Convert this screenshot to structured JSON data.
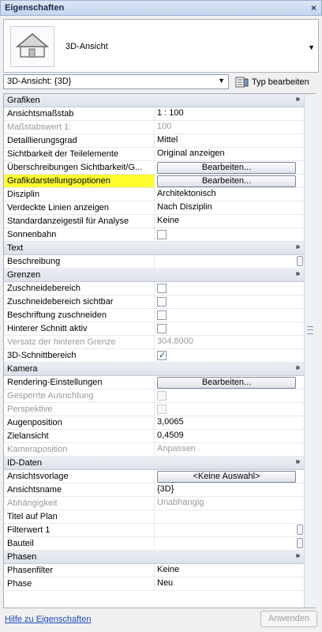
{
  "window": {
    "title": "Eigenschaften",
    "close": "×"
  },
  "type_selector": {
    "name": "3D-Ansicht"
  },
  "view_select": {
    "value": "3D-Ansicht: {3D}"
  },
  "edit_type": {
    "label": "Typ bearbeiten"
  },
  "sections": {
    "grafiken": "Grafiken",
    "text": "Text",
    "grenzen": "Grenzen",
    "kamera": "Kamera",
    "id_daten": "ID-Daten",
    "phasen": "Phasen"
  },
  "rows": {
    "ansichtsmassstab": {
      "label": "Ansichtsmaßstab",
      "value": "1 : 100"
    },
    "massstabswert": {
      "label": "Maßstabswert 1:",
      "value": "100"
    },
    "detaillierungsgrad": {
      "label": "Detaillierungsgrad",
      "value": "Mittel"
    },
    "sichtbarkeit_teile": {
      "label": "Sichtbarkeit der Teilelemente",
      "value": "Original anzeigen"
    },
    "ueberschreibungen": {
      "label": "Überschreibungen Sichtbarkeit/G...",
      "button": "Bearbeiten..."
    },
    "grafikdarstellung": {
      "label": "Grafikdarstellungsoptionen",
      "button": "Bearbeiten..."
    },
    "disziplin": {
      "label": "Disziplin",
      "value": "Architektonisch"
    },
    "verdeckte_linien": {
      "label": "Verdeckte Linien anzeigen",
      "value": "Nach Disziplin"
    },
    "standardanzeigestil": {
      "label": "Standardanzeigestil für Analyse",
      "value": "Keine"
    },
    "sonnenbahn": {
      "label": "Sonnenbahn"
    },
    "beschreibung": {
      "label": "Beschreibung"
    },
    "zuschneidebereich": {
      "label": "Zuschneidebereich"
    },
    "zuschneidebereich_sichtbar": {
      "label": "Zuschneidebereich sichtbar"
    },
    "beschriftung_zuschneiden": {
      "label": "Beschriftung zuschneiden"
    },
    "hinterer_schnitt": {
      "label": "Hinterer Schnitt aktiv"
    },
    "versatz": {
      "label": "Versatz der hinteren Grenze",
      "value": "304,8000"
    },
    "schnittbereich_3d": {
      "label": "3D-Schnittbereich"
    },
    "rendering": {
      "label": "Rendering-Einstellungen",
      "button": "Bearbeiten..."
    },
    "gesperrte_ausrichtung": {
      "label": "Gesperrte Ausrichtung"
    },
    "perspektive": {
      "label": "Perspektive"
    },
    "augenposition": {
      "label": "Augenposition",
      "value": "3,0065"
    },
    "zielansicht": {
      "label": "Zielansicht",
      "value": "0,4509"
    },
    "kameraposition": {
      "label": "Kameraposition",
      "value": "Anpassen"
    },
    "ansichtsvorlage": {
      "label": "Ansichtsvorlage",
      "button": "<Keine Auswahl>"
    },
    "ansichtsname": {
      "label": "Ansichtsname",
      "value": "{3D}"
    },
    "abhaengigkeit": {
      "label": "Abhängigkeit",
      "value": "Unabhängig"
    },
    "titel_auf_plan": {
      "label": "Titel auf Plan"
    },
    "filterwert": {
      "label": "Filterwert 1"
    },
    "bauteil": {
      "label": "Bauteil"
    },
    "phasenfilter": {
      "label": "Phasenfilter",
      "value": "Keine"
    },
    "phase": {
      "label": "Phase",
      "value": "Neu"
    }
  },
  "footer": {
    "help_link": "Hilfe zu Eigenschaften",
    "apply": "Anwenden"
  },
  "colors": {
    "highlight": "#ffff30",
    "link": "#1a4cc0"
  }
}
